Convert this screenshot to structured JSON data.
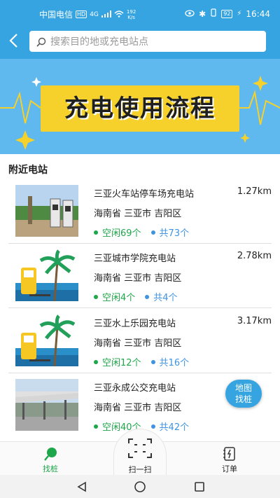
{
  "status_bar": {
    "carrier": "中国电信",
    "net_badge": "HD",
    "signal": "4G",
    "speed_value": "192",
    "speed_unit": "K/s",
    "battery": "92",
    "time": "16:44"
  },
  "search": {
    "placeholder": "搜索目的地或充电站点"
  },
  "banner": {
    "title": "充电使用流程"
  },
  "nearby": {
    "title": "附近电站",
    "stations": [
      {
        "name": "三亚火车站停车场充电站",
        "distance": "1.27km",
        "address": "海南省 三亚市 吉阳区",
        "free": "空闲69个",
        "total": "共73个",
        "thumb": "photo-station-icon"
      },
      {
        "name": "三亚城市学院充电站",
        "distance": "2.78km",
        "address": "海南省 三亚市 吉阳区",
        "free": "空闲4个",
        "total": "共4个",
        "thumb": "palm-charger-icon"
      },
      {
        "name": "三亚水上乐园充电站",
        "distance": "3.17km",
        "address": "海南省 三亚市 吉阳区",
        "free": "空闲12个",
        "total": "共16个",
        "thumb": "palm-charger-icon"
      },
      {
        "name": "三亚永成公交充电站",
        "distance": "",
        "address": "海南省 三亚市 吉阳区",
        "free": "空闲40个",
        "total": "共42个",
        "thumb": "photo-bus-station-icon"
      }
    ]
  },
  "map_button": {
    "line1": "地图",
    "line2": "找桩"
  },
  "bottom_nav": {
    "find": "找桩",
    "scan": "扫一扫",
    "orders": "订单"
  },
  "colors": {
    "primary": "#35a4e0",
    "free": "#1ea64a",
    "total": "#3f93e0",
    "banner_box": "#f6d12c"
  }
}
